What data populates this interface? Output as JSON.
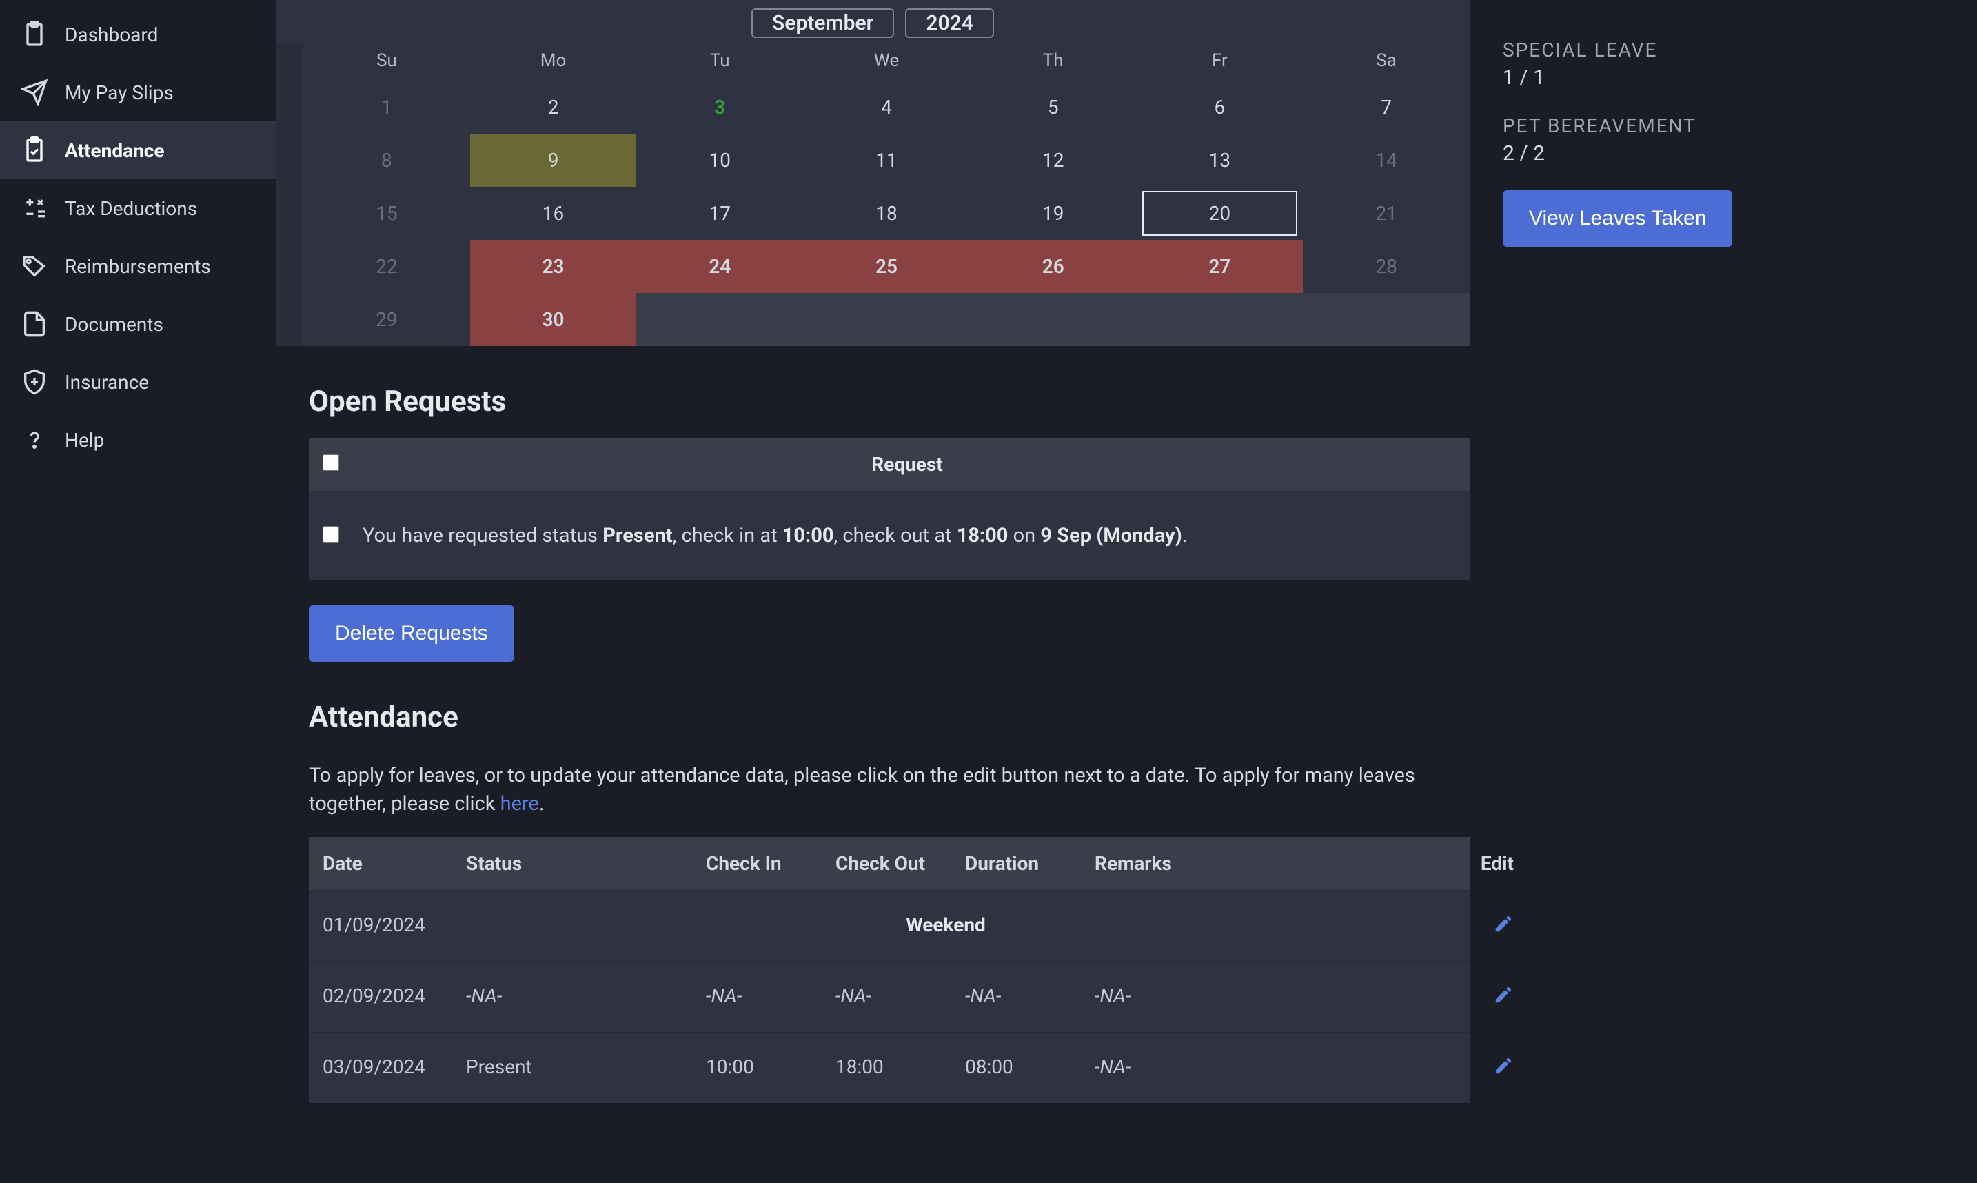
{
  "sidebar": {
    "items": [
      {
        "icon": "clipboard",
        "label": "Dashboard"
      },
      {
        "icon": "paper-plane",
        "label": "My Pay Slips"
      },
      {
        "icon": "clipboard-check",
        "label": "Attendance"
      },
      {
        "icon": "calculator",
        "label": "Tax Deductions"
      },
      {
        "icon": "tag",
        "label": "Reimbursements"
      },
      {
        "icon": "document",
        "label": "Documents"
      },
      {
        "icon": "shield-plus",
        "label": "Insurance"
      },
      {
        "icon": "question",
        "label": "Help"
      }
    ]
  },
  "calendar": {
    "month": "September",
    "year": "2024",
    "dow": [
      "Su",
      "Mo",
      "Tu",
      "We",
      "Th",
      "Fr",
      "Sa"
    ],
    "cells": [
      {
        "d": "1",
        "cls": "dim"
      },
      {
        "d": "2"
      },
      {
        "d": "3",
        "cls": "today"
      },
      {
        "d": "4"
      },
      {
        "d": "5"
      },
      {
        "d": "6"
      },
      {
        "d": "7"
      },
      {
        "d": "8",
        "cls": "dim"
      },
      {
        "d": "9",
        "cls": "olive"
      },
      {
        "d": "10"
      },
      {
        "d": "11"
      },
      {
        "d": "12"
      },
      {
        "d": "13"
      },
      {
        "d": "14",
        "cls": "dim"
      },
      {
        "d": "15",
        "cls": "dim"
      },
      {
        "d": "16"
      },
      {
        "d": "17"
      },
      {
        "d": "18"
      },
      {
        "d": "19"
      },
      {
        "d": "20",
        "cls": "outlined"
      },
      {
        "d": "21",
        "cls": "dim"
      },
      {
        "d": "22",
        "cls": "dim"
      },
      {
        "d": "23",
        "cls": "red"
      },
      {
        "d": "24",
        "cls": "red"
      },
      {
        "d": "25",
        "cls": "red"
      },
      {
        "d": "26",
        "cls": "red"
      },
      {
        "d": "27",
        "cls": "red"
      },
      {
        "d": "28",
        "cls": "dim"
      },
      {
        "d": "29",
        "cls": "dim"
      },
      {
        "d": "30",
        "cls": "red"
      },
      {
        "d": "",
        "cls": "noinfo"
      },
      {
        "d": "",
        "cls": "noinfo"
      },
      {
        "d": "",
        "cls": "noinfo"
      },
      {
        "d": "",
        "cls": "noinfo"
      },
      {
        "d": "",
        "cls": "noinfo"
      }
    ]
  },
  "open_requests": {
    "title": "Open Requests",
    "header": "Request",
    "row": {
      "pre": "You have requested status ",
      "status": "Present",
      "mid1": ", check in at ",
      "checkin": "10:00",
      "mid2": ", check out at ",
      "checkout": "18:00",
      "mid3": " on ",
      "date": "9 Sep (Monday)",
      "end": "."
    },
    "delete_label": "Delete Requests"
  },
  "attendance": {
    "title": "Attendance",
    "desc1": "To apply for leaves, or to update your attendance data, please click on the edit button next to a date. To apply for many leaves together, please click ",
    "link": "here",
    "desc2": ".",
    "headers": {
      "date": "Date",
      "status": "Status",
      "checkin": "Check In",
      "checkout": "Check Out",
      "duration": "Duration",
      "remarks": "Remarks",
      "edit": "Edit"
    },
    "rows": [
      {
        "date": "01/09/2024",
        "weekend": "Weekend"
      },
      {
        "date": "02/09/2024",
        "status": "-NA-",
        "checkin": "-NA-",
        "checkout": "-NA-",
        "duration": "-NA-",
        "remarks": "-NA-",
        "na": true
      },
      {
        "date": "03/09/2024",
        "status": "Present",
        "checkin": "10:00",
        "checkout": "18:00",
        "duration": "08:00",
        "remarks": "-NA-",
        "remarks_na": true
      }
    ]
  },
  "leaves": {
    "special": {
      "title": "SPECIAL LEAVE",
      "value": "1 / 1"
    },
    "pet": {
      "title": "PET BEREAVEMENT",
      "value": "2 / 2"
    },
    "button": "View Leaves Taken"
  }
}
